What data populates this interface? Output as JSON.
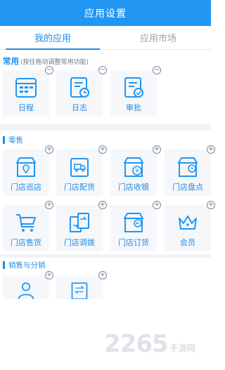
{
  "header": {
    "title": "应用设置"
  },
  "tabs": [
    {
      "label": "我的应用",
      "active": true
    },
    {
      "label": "应用市场",
      "active": false
    }
  ],
  "common": {
    "title": "常用",
    "hint": "(按住拖动调整常用功能)",
    "apps": [
      {
        "label": "日程",
        "icon": "calendar-icon"
      },
      {
        "label": "日志",
        "icon": "journal-clock-icon"
      },
      {
        "label": "审批",
        "icon": "approval-icon"
      }
    ]
  },
  "retail": {
    "title": "零售",
    "apps": [
      {
        "label": "门店巡店",
        "icon": "store-location-icon"
      },
      {
        "label": "门店配货",
        "icon": "delivery-truck-icon"
      },
      {
        "label": "门店收银",
        "icon": "store-yen-icon"
      },
      {
        "label": "门店盘点",
        "icon": "store-clock-icon"
      },
      {
        "label": "门店售货",
        "icon": "shopping-cart-icon"
      },
      {
        "label": "门店调拨",
        "icon": "transfer-docs-icon"
      },
      {
        "label": "门店订货",
        "icon": "store-return-icon"
      },
      {
        "label": "会员",
        "icon": "crown-icon"
      }
    ]
  },
  "sales": {
    "title": "销售与分销",
    "apps": [
      {
        "icon": "person-icon"
      },
      {
        "icon": "transfer-card-icon"
      }
    ]
  },
  "watermark": {
    "big": "2265",
    "small": "手游网"
  },
  "colors": {
    "primary": "#2196f3",
    "accent": "#1f8bea",
    "tile": "#f5f7fa"
  }
}
